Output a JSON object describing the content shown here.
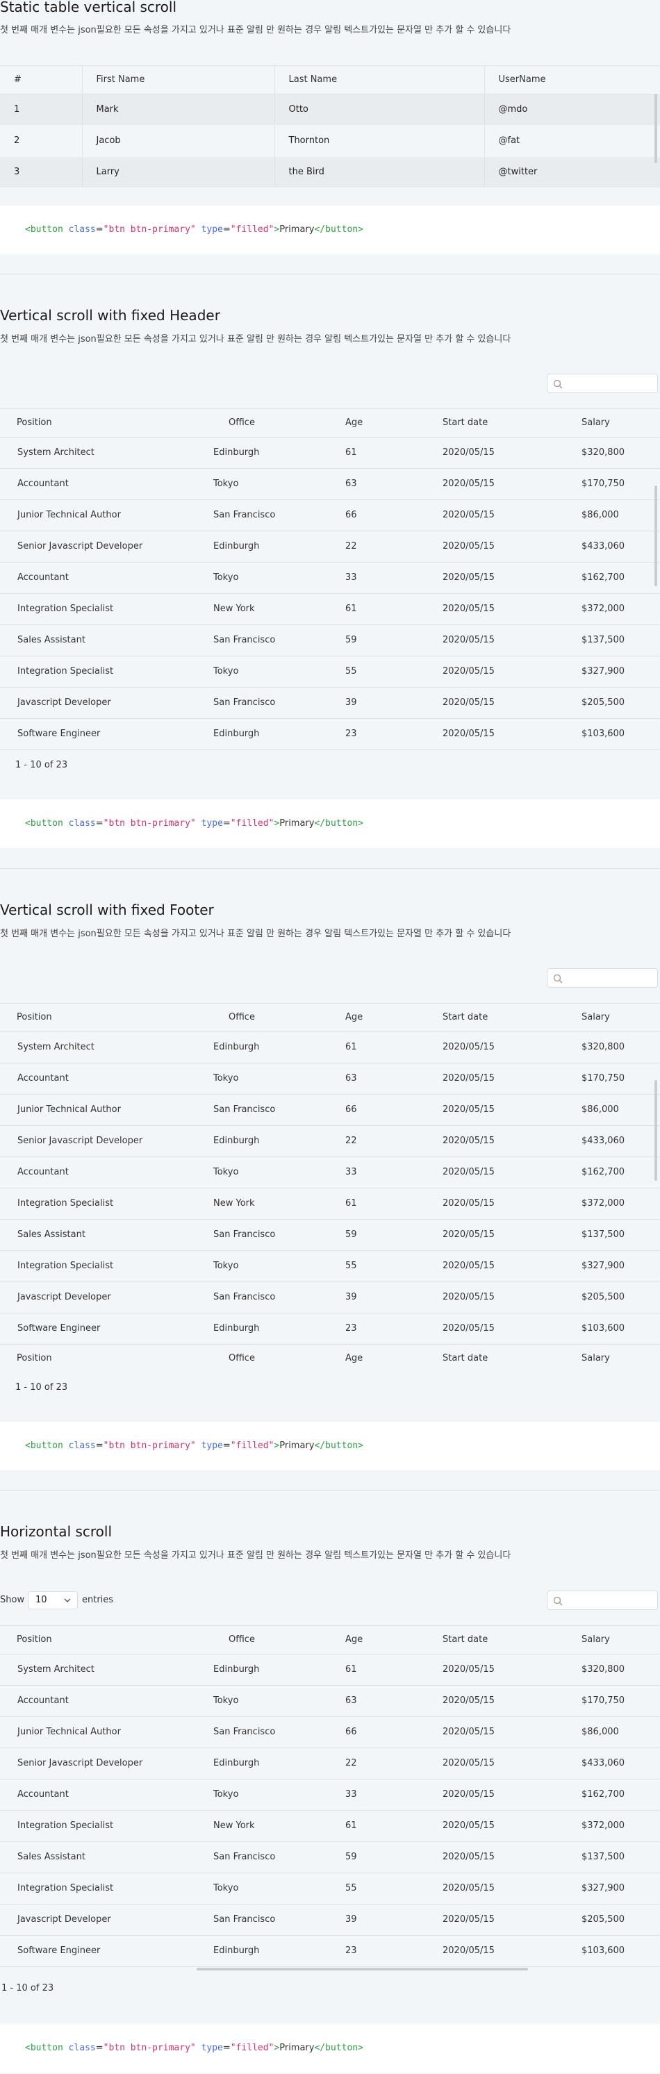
{
  "description": "첫 번째 매개 변수는 json필요한 모든 속성을 가지고 있거나 표준 알림 만 원하는 경우 알림 텍스트가있는 문자열 만 추가 할 수 있습니다",
  "code_snippet": {
    "open": "<button ",
    "attr_class": "class",
    "eq1": "=",
    "val_class": "\"btn btn-primary\"",
    "attr_type": "type",
    "eq2": "=",
    "val_type": "\"filled\"",
    "close_open": ">",
    "text": "Primary",
    "close_tag": "</button>"
  },
  "static_table": {
    "title": "Static table vertical scroll",
    "headers": [
      "#",
      "First Name",
      "Last Name",
      "UserName"
    ],
    "rows": [
      [
        "1",
        "Mark",
        "Otto",
        "@mdo"
      ],
      [
        "2",
        "Jacob",
        "Thornton",
        "@fat"
      ],
      [
        "3",
        "Larry",
        "the Bird",
        "@twitter"
      ]
    ]
  },
  "section_titles": {
    "fixed_header": "Vertical scroll with fixed Header",
    "fixed_footer": "Vertical scroll with fixed Footer",
    "horizontal": "Horizontal scroll"
  },
  "datatable": {
    "headers": [
      "Position",
      "Office",
      "Age",
      "Start date",
      "Salary"
    ],
    "rows": [
      [
        "System Architect",
        "Edinburgh",
        "61",
        "2020/05/15",
        "$320,800"
      ],
      [
        "Accountant",
        "Tokyo",
        "63",
        "2020/05/15",
        "$170,750"
      ],
      [
        "Junior Technical Author",
        "San Francisco",
        "66",
        "2020/05/15",
        "$86,000"
      ],
      [
        "Senior Javascript Developer",
        "Edinburgh",
        "22",
        "2020/05/15",
        "$433,060"
      ],
      [
        "Accountant",
        "Tokyo",
        "33",
        "2020/05/15",
        "$162,700"
      ],
      [
        "Integration Specialist",
        "New York",
        "61",
        "2020/05/15",
        "$372,000"
      ],
      [
        "Sales Assistant",
        "San Francisco",
        "59",
        "2020/05/15",
        "$137,500"
      ],
      [
        "Integration Specialist",
        "Tokyo",
        "55",
        "2020/05/15",
        "$327,900"
      ],
      [
        "Javascript Developer",
        "San Francisco",
        "39",
        "2020/05/15",
        "$205,500"
      ],
      [
        "Software Engineer",
        "Edinburgh",
        "23",
        "2020/05/15",
        "$103,600"
      ]
    ],
    "info": "1 - 10 of 23"
  },
  "length_menu": {
    "show_label": "Show",
    "value": "10",
    "entries_label": "entries"
  },
  "icons": {
    "search": "search-icon",
    "chevron": "chevron-down-icon"
  }
}
